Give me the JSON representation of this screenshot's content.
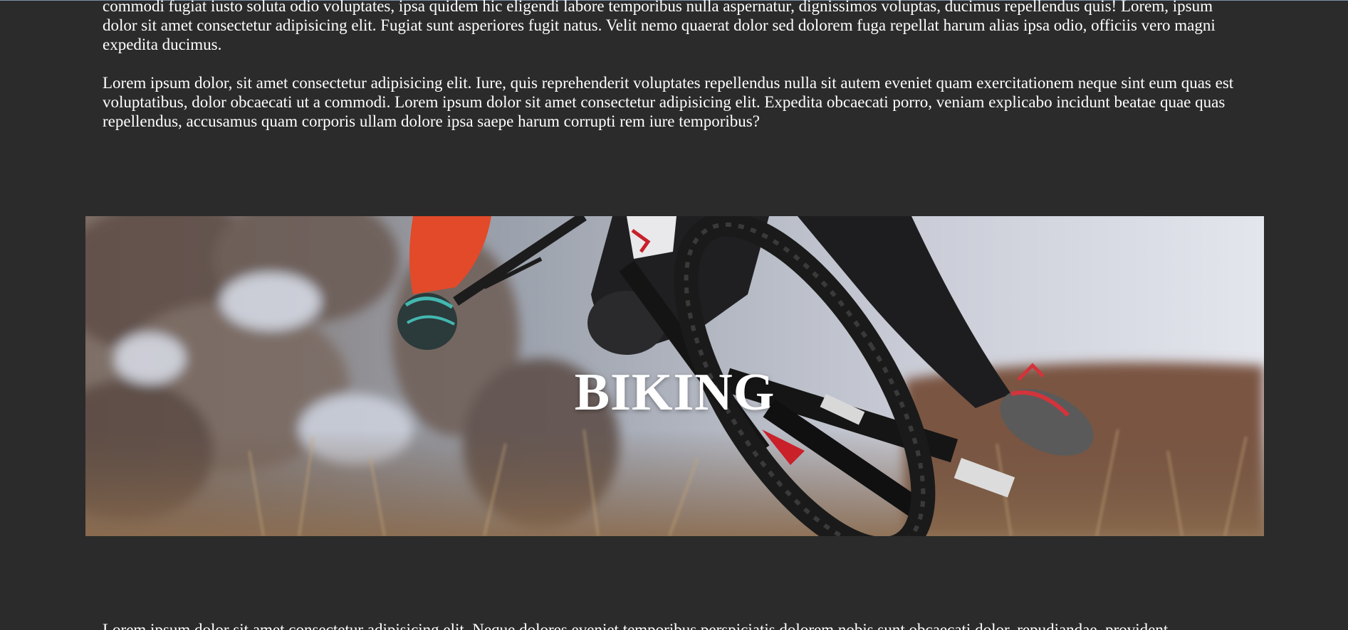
{
  "paragraphs": [
    {
      "text": "commodi fugiat iusto soluta odio voluptates, ipsa quidem hic eligendi labore temporibus nulla aspernatur, dignissimos voluptas, ducimus repellendus quis! Lorem, ipsum dolor sit amet consectetur adipisicing elit. Fugiat sunt asperiores fugit natus. Velit nemo quaerat dolor sed dolorem fuga repellat harum alias ipsa odio, officiis vero magni expedita ducimus."
    },
    {
      "text": "Lorem ipsum dolor, sit amet consectetur adipisicing elit. Iure, quis reprehenderit voluptates repellendus nulla sit autem eveniet quam exercitationem neque sint eum quas est voluptatibus, dolor obcaecati ut a commodi. Lorem ipsum dolor sit amet consectetur adipisicing elit. Expedita obcaecati porro, veniam explicabo incidunt beatae quae quas repellendus, accusamus quam corporis ullam dolore ipsa saepe harum corrupti rem iure temporibus?"
    },
    {
      "text": "Lorem ipsum dolor sit amet consectetur adipisicing elit. Neque dolores eveniet temporibus perspiciatis dolorem nobis sunt obcaecati dolor, repudiandae, provident."
    }
  ],
  "banner": {
    "title": "BIKING",
    "image": "mountain-biker-photo"
  },
  "colors": {
    "page_background": "#2b2b2b",
    "text": "#ffffff"
  }
}
